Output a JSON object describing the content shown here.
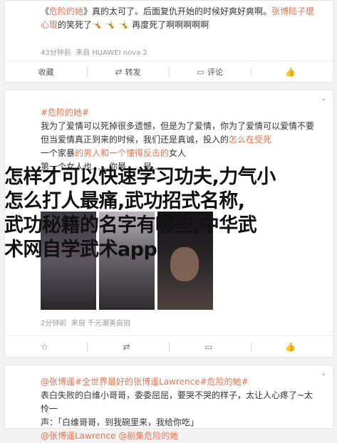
{
  "post1": {
    "text_a": "《",
    "link_a": "危险的她",
    "text_b": "》真",
    "text_c": "的太可了。后面复仇开始的时候好爽好爽啊。",
    "link_b": "张博",
    "text_d": "陆子琨",
    "line2": "心琨",
    "line2_mid": "的笑死了",
    "line2_end": "🤸 🤸 🤸 再度死了啊啊啊啊啊",
    "time": "43分钟前",
    "device": "来自 HUAWEI nova 2"
  },
  "post2": {
    "tag": "#危险的她#",
    "line1": "我为了爱情可以死掉很多遗憾，但是为了爱情，你为了爱情可以爱情不要",
    "line2": "但当爱情真正到来的时候，我们还是真诚，投入的",
    "line2_end": "怎么在受死",
    "line3": "一个家暴",
    "line3_link": "的男人和一个懂得反击的",
    "line3_end": "女人",
    "line4": "第一个女人也……你最……是……",
    "time": "2分钟前",
    "device": "来自 千元潮美自拍"
  },
  "overlay": {
    "line1": "怎样才可以快速学习功夫,力气小",
    "line2": "怎么打人最痛,武功招式名称,",
    "line3": "武功秘籍的名字有哪些,中华武",
    "line4": "术网自学武术app"
  },
  "post3": {
    "line1_link": "@张博遥#全世界最好的",
    "line1_mid": "张博遥Lawrence",
    "line1_end": "#危险的她#",
    "line2": "表白失败的白维小哥哥，委委屈屈，要哭不哭的样子，太让人心疼了~太怜一",
    "line3": "声：「白维哥哥，到我碗里来，我给你吃」",
    "line4_link": "@张博遥Lawrence",
    "line4_mid": "@剧集危险的她",
    "line4_end": ""
  },
  "actions": {
    "favorite": "收藏",
    "repost": "转发",
    "repost_count": "",
    "comment": "评论",
    "like": ""
  },
  "repost_icon": "repost-icon",
  "comment_icon": "comment-icon",
  "like_icon": "thumb-up-icon",
  "favorite_icon": "star-icon",
  "colors": {
    "link": "#eb7350",
    "overlay_text": "#111111",
    "bg": "#f2f2f2"
  }
}
